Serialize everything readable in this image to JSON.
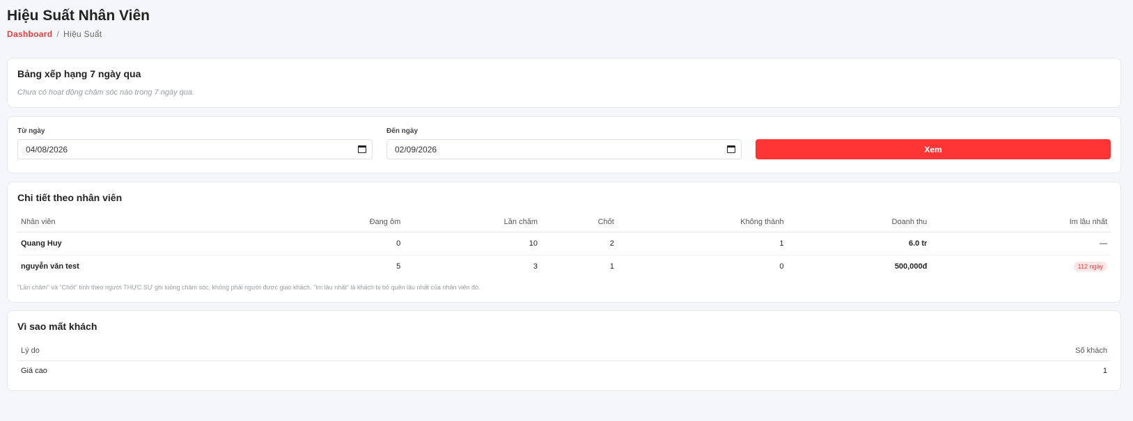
{
  "page": {
    "title": "Hiệu Suất Nhân Viên",
    "breadcrumb": {
      "home": "Dashboard",
      "separator": "/",
      "current": "Hiệu Suất"
    }
  },
  "ranking": {
    "title": "Bảng xếp hạng 7 ngày qua",
    "empty_text": "Chưa có hoạt động chăm sóc nào trong 7 ngày qua."
  },
  "filter": {
    "from_label": "Từ ngày",
    "from_value": "04/08/2026",
    "to_label": "Đến ngày",
    "to_value": "02/09/2026",
    "view_button": "Xem"
  },
  "detail": {
    "title": "Chi tiết theo nhân viên",
    "headers": [
      "Nhân viên",
      "Đang ôm",
      "Lần chăm",
      "Chốt",
      "Không thành",
      "Doanh thu",
      "Im lâu nhất"
    ],
    "rows": [
      {
        "name": "Quang Huy",
        "holding": "0",
        "touches": "10",
        "closed": "2",
        "failed": "1",
        "revenue": "6.0 tr",
        "idle": "—"
      },
      {
        "name": "nguyễn văn test",
        "holding": "5",
        "touches": "3",
        "closed": "1",
        "failed": "0",
        "revenue": "500,000đ",
        "idle": "112 ngày"
      }
    ],
    "footnote": "\"Lần chăm\" và \"Chốt\" tính theo người THỰC SỰ ghi luồng chăm sóc, không phải người được giao khách. \"Im lâu nhất\" là khách bị bỏ quên lâu nhất của nhân viên đó."
  },
  "reasons": {
    "title": "Vì sao mất khách",
    "headers": [
      "Lý do",
      "Số khách"
    ],
    "rows": [
      {
        "reason": "Giá cao",
        "count": "1"
      }
    ]
  },
  "colors": {
    "accent": "#ff3535",
    "link": "#e83a3a",
    "badge_bg": "#fde6e6",
    "badge_text": "#e04545"
  }
}
